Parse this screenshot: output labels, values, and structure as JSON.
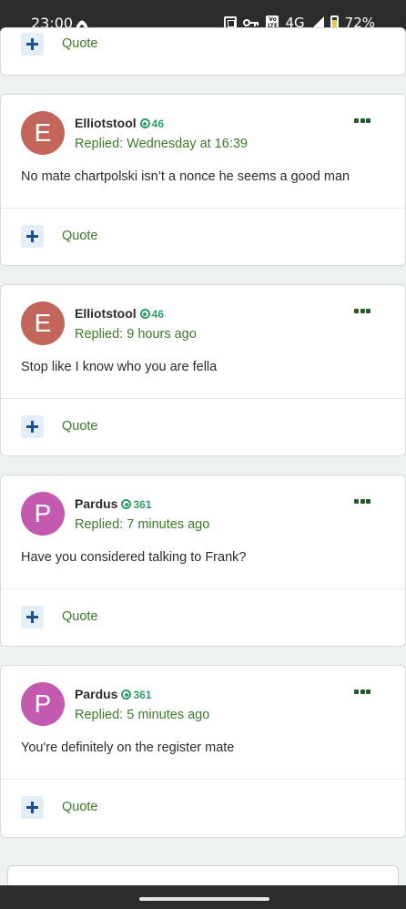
{
  "status_bar": {
    "time": "23:00",
    "app_icon": "arch-icon",
    "network": "4G",
    "volte": "Vo LTE",
    "battery": "72%"
  },
  "quote_label": "Quote",
  "posts": [
    {
      "avatar_letter": "E",
      "avatar_color": "#c2655a",
      "username": "Elliotstool",
      "reputation": "46",
      "replied": "Replied: Wednesday at 16:39",
      "message": "No mate chartpolski isn’t a nonce he seems a good man"
    },
    {
      "avatar_letter": "E",
      "avatar_color": "#c2655a",
      "username": "Elliotstool",
      "reputation": "46",
      "replied": "Replied: 9 hours ago",
      "message": "Stop like I know who you are fella"
    },
    {
      "avatar_letter": "P",
      "avatar_color": "#c35ab0",
      "username": "Pardus",
      "reputation": "361",
      "replied": "Replied: 7 minutes ago",
      "message": "Have you considered talking to Frank?"
    },
    {
      "avatar_letter": "P",
      "avatar_color": "#c35ab0",
      "username": "Pardus",
      "reputation": "361",
      "replied": "Replied: 5 minutes ago",
      "message": "You're definitely on the register mate"
    }
  ]
}
